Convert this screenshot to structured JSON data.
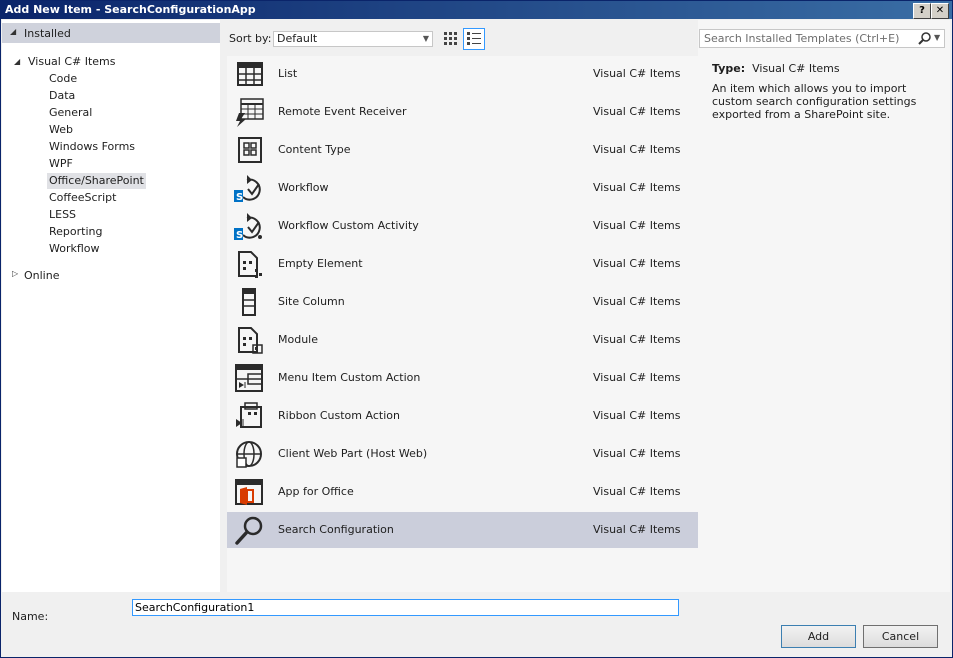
{
  "window": {
    "title": "Add New Item - SearchConfigurationApp",
    "help_label": "?",
    "close_label": "✕"
  },
  "left_pane": {
    "installed_label": "Installed",
    "visual_csharp_label": "Visual C# Items",
    "categories": [
      {
        "label": "Code"
      },
      {
        "label": "Data"
      },
      {
        "label": "General"
      },
      {
        "label": "Web"
      },
      {
        "label": "Windows Forms"
      },
      {
        "label": "WPF"
      },
      {
        "label": "Office/SharePoint"
      },
      {
        "label": "CoffeeScript"
      },
      {
        "label": "LESS"
      },
      {
        "label": "Reporting"
      },
      {
        "label": "Workflow"
      }
    ],
    "selected_category": "Office/SharePoint",
    "online_label": "Online"
  },
  "toolbar": {
    "sort_label": "Sort by:",
    "sort_value": "Default",
    "view_mode": "list"
  },
  "templates": [
    {
      "name": "List",
      "type": "Visual C# Items",
      "icon": "list-grid-icon"
    },
    {
      "name": "Remote Event Receiver",
      "type": "Visual C# Items",
      "icon": "remote-event-receiver-icon"
    },
    {
      "name": "Content Type",
      "type": "Visual C# Items",
      "icon": "content-type-icon"
    },
    {
      "name": "Workflow",
      "type": "Visual C# Items",
      "icon": "workflow-icon"
    },
    {
      "name": "Workflow Custom Activity",
      "type": "Visual C# Items",
      "icon": "workflow-custom-activity-icon"
    },
    {
      "name": "Empty Element",
      "type": "Visual C# Items",
      "icon": "empty-element-icon"
    },
    {
      "name": "Site Column",
      "type": "Visual C# Items",
      "icon": "site-column-icon"
    },
    {
      "name": "Module",
      "type": "Visual C# Items",
      "icon": "module-icon"
    },
    {
      "name": "Menu Item Custom Action",
      "type": "Visual C# Items",
      "icon": "menu-item-custom-action-icon"
    },
    {
      "name": "Ribbon Custom Action",
      "type": "Visual C# Items",
      "icon": "ribbon-custom-action-icon"
    },
    {
      "name": "Client Web Part (Host Web)",
      "type": "Visual C# Items",
      "icon": "client-web-part-icon"
    },
    {
      "name": "App for Office",
      "type": "Visual C# Items",
      "icon": "app-for-office-icon"
    },
    {
      "name": "Search Configuration",
      "type": "Visual C# Items",
      "icon": "search-configuration-icon"
    }
  ],
  "selected_template": "Search Configuration",
  "details": {
    "search_placeholder": "Search Installed Templates (Ctrl+E)",
    "type_label": "Type:",
    "type_value": "Visual C# Items",
    "description": "An item which allows you to import custom search configuration settings exported from a SharePoint site."
  },
  "footer": {
    "name_label": "Name:",
    "name_value": "SearchConfiguration1",
    "add_label": "Add",
    "cancel_label": "Cancel"
  },
  "colors": {
    "title_bar": "#0a246a",
    "selection": "#cbcedb",
    "focus_border": "#3399ff",
    "office_red": "#d83b01",
    "sharepoint_blue": "#0072c6"
  }
}
